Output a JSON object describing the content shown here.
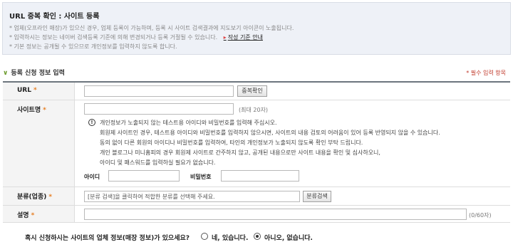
{
  "info": {
    "title": "URL 중복 확인 : 사이트 등록",
    "lines": [
      "* 업체(오프라인 매장)가 있으신 경우, 업체 등록이 가능하며, 등록 시 사이트 검색결과에 지도보기 아이콘이 노출됩니다.",
      "* 입력하시는 정보는 네이버 검색등록 기준에 의해 변경되거나 등록 거절될 수 있습니다.",
      "* 기본 정보는 공개될 수 있으므로 개인정보를 입력하지 않도록 합니다."
    ],
    "guide_link": "작성 기준 안내"
  },
  "section": {
    "title": "등록 신청 정보 입력",
    "required_note": "* 필수 입력 항목"
  },
  "form": {
    "url": {
      "label": "URL",
      "button": "중복확인",
      "value": ""
    },
    "site_name": {
      "label": "사이트명",
      "limit": "(최대 20자)",
      "value": "",
      "notes": [
        "개인정보가 노출되지 않는 테스트용 아이디와 비밀번호를 입력해 주십시오.",
        "회원제 사이트인 경우, 테스트용 아이디와 비밀번호를 입력하지 않으시면, 사이트의 내용 검토의 어려움이 있어 등록 반영되지 않을 수 있습니다.",
        "동의 없이 다른 회원의 아이디나 비밀번호를 입력하여, 타인의 개인정보가 노출되지 않도록 확인 부탁 드립니다.",
        "개인 블로그나 미니홈피의 경우 회원제 사이트로 간주하지 않고, 공개된 내용으로만 사이트 내용을 확인 및 심사하오니,",
        "아이디 및 패스워드를 입력하실 필요가 없습니다."
      ],
      "id_label": "아이디",
      "pw_label": "비밀번호"
    },
    "category": {
      "label": "분류(업종)",
      "placeholder": "[분류 검색]을 클릭하여 적합한 분류를 선택해 주세요.",
      "button": "분류검색"
    },
    "description": {
      "label": "설명",
      "counter": "(0/60자)",
      "value": ""
    },
    "required_star": "*"
  },
  "question": {
    "text": "혹시 신청하시는 사이트의 업체 정보(매장 정보)가 있으세요?",
    "options": [
      "네, 있습니다.",
      "아니오, 없습니다."
    ],
    "selected": 1
  }
}
